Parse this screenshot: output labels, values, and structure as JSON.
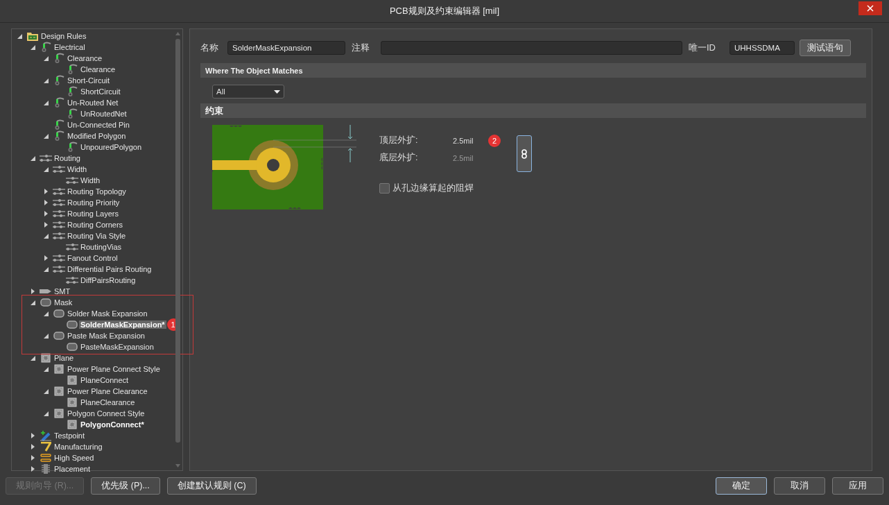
{
  "window": {
    "title": "PCB规则及约束编辑器 [mil]"
  },
  "tree": [
    {
      "label": "Design Rules",
      "kind": "folder",
      "expanded": true,
      "children": [
        {
          "label": "Electrical",
          "kind": "electrical",
          "expanded": true,
          "children": [
            {
              "label": "Clearance",
              "kind": "electrical",
              "expanded": true,
              "children": [
                {
                  "label": "Clearance",
                  "kind": "electrical"
                }
              ]
            },
            {
              "label": "Short-Circuit",
              "kind": "electrical",
              "expanded": true,
              "children": [
                {
                  "label": "ShortCircuit",
                  "kind": "electrical"
                }
              ]
            },
            {
              "label": "Un-Routed Net",
              "kind": "electrical",
              "expanded": true,
              "children": [
                {
                  "label": "UnRoutedNet",
                  "kind": "electrical"
                }
              ]
            },
            {
              "label": "Un-Connected Pin",
              "kind": "electrical"
            },
            {
              "label": "Modified Polygon",
              "kind": "electrical",
              "expanded": true,
              "children": [
                {
                  "label": "UnpouredPolygon",
                  "kind": "electrical"
                }
              ]
            }
          ]
        },
        {
          "label": "Routing",
          "kind": "routing",
          "expanded": true,
          "children": [
            {
              "label": "Width",
              "kind": "routing",
              "expanded": true,
              "children": [
                {
                  "label": "Width",
                  "kind": "routing"
                }
              ]
            },
            {
              "label": "Routing Topology",
              "kind": "routing",
              "expanded": false
            },
            {
              "label": "Routing Priority",
              "kind": "routing",
              "expanded": false
            },
            {
              "label": "Routing Layers",
              "kind": "routing",
              "expanded": false
            },
            {
              "label": "Routing Corners",
              "kind": "routing",
              "expanded": false
            },
            {
              "label": "Routing Via Style",
              "kind": "routing",
              "expanded": true,
              "children": [
                {
                  "label": "RoutingVias",
                  "kind": "routing"
                }
              ]
            },
            {
              "label": "Fanout Control",
              "kind": "routing",
              "expanded": false
            },
            {
              "label": "Differential Pairs Routing",
              "kind": "routing",
              "expanded": true,
              "children": [
                {
                  "label": "DiffPairsRouting",
                  "kind": "routing"
                }
              ]
            }
          ]
        },
        {
          "label": "SMT",
          "kind": "smt",
          "expanded": false
        },
        {
          "label": "Mask",
          "kind": "mask",
          "expanded": true,
          "children": [
            {
              "label": "Solder Mask Expansion",
              "kind": "mask",
              "expanded": true,
              "children": [
                {
                  "label": "SolderMaskExpansion*",
                  "kind": "mask",
                  "selected": true,
                  "modified": true,
                  "badge": "1"
                }
              ]
            },
            {
              "label": "Paste Mask Expansion",
              "kind": "mask",
              "expanded": true,
              "children": [
                {
                  "label": "PasteMaskExpansion",
                  "kind": "mask",
                  "selected": false,
                  "modified": false
                }
              ]
            }
          ]
        },
        {
          "label": "Plane",
          "kind": "plane",
          "expanded": true,
          "children": [
            {
              "label": "Power Plane Connect Style",
              "kind": "plane",
              "expanded": true,
              "children": [
                {
                  "label": "PlaneConnect",
                  "kind": "plane"
                }
              ]
            },
            {
              "label": "Power Plane Clearance",
              "kind": "plane",
              "expanded": true,
              "children": [
                {
                  "label": "PlaneClearance",
                  "kind": "plane"
                }
              ]
            },
            {
              "label": "Polygon Connect Style",
              "kind": "plane",
              "expanded": true,
              "children": [
                {
                  "label": "PolygonConnect*",
                  "kind": "plane",
                  "modified": true
                }
              ]
            }
          ]
        },
        {
          "label": "Testpoint",
          "kind": "testpoint",
          "expanded": false
        },
        {
          "label": "Manufacturing",
          "kind": "manufacturing",
          "expanded": false
        },
        {
          "label": "High Speed",
          "kind": "highspeed",
          "expanded": false
        },
        {
          "label": "Placement",
          "kind": "placement",
          "expanded": false
        }
      ]
    }
  ],
  "rule": {
    "name_label": "名称",
    "name": "SolderMaskExpansion",
    "comment_label": "注释",
    "id_label": "唯一ID",
    "id": "UHHSSDMA",
    "test_button": "测试语句"
  },
  "match": {
    "title": "Where The Object Matches",
    "scope": "All"
  },
  "constraints": {
    "title": "约束",
    "badge": "2",
    "fields": [
      {
        "label": "顶层外扩:",
        "value": "2.5mil",
        "disabled": false
      },
      {
        "label": "底层外扩:",
        "value": "2.5mil",
        "disabled": true
      }
    ],
    "from_hole_edge": {
      "label": "从孔边缘算起的阻焊",
      "checked": false
    }
  },
  "footer": {
    "left": [
      {
        "label": "规则向导 (R)...",
        "disabled": true
      },
      {
        "label": "优先级 (P)...",
        "disabled": false
      },
      {
        "label": "创建默认规则 (C)",
        "disabled": false
      }
    ],
    "right": [
      {
        "label": "确定",
        "default": true
      },
      {
        "label": "取消",
        "default": false
      },
      {
        "label": "应用",
        "default": false
      }
    ]
  }
}
